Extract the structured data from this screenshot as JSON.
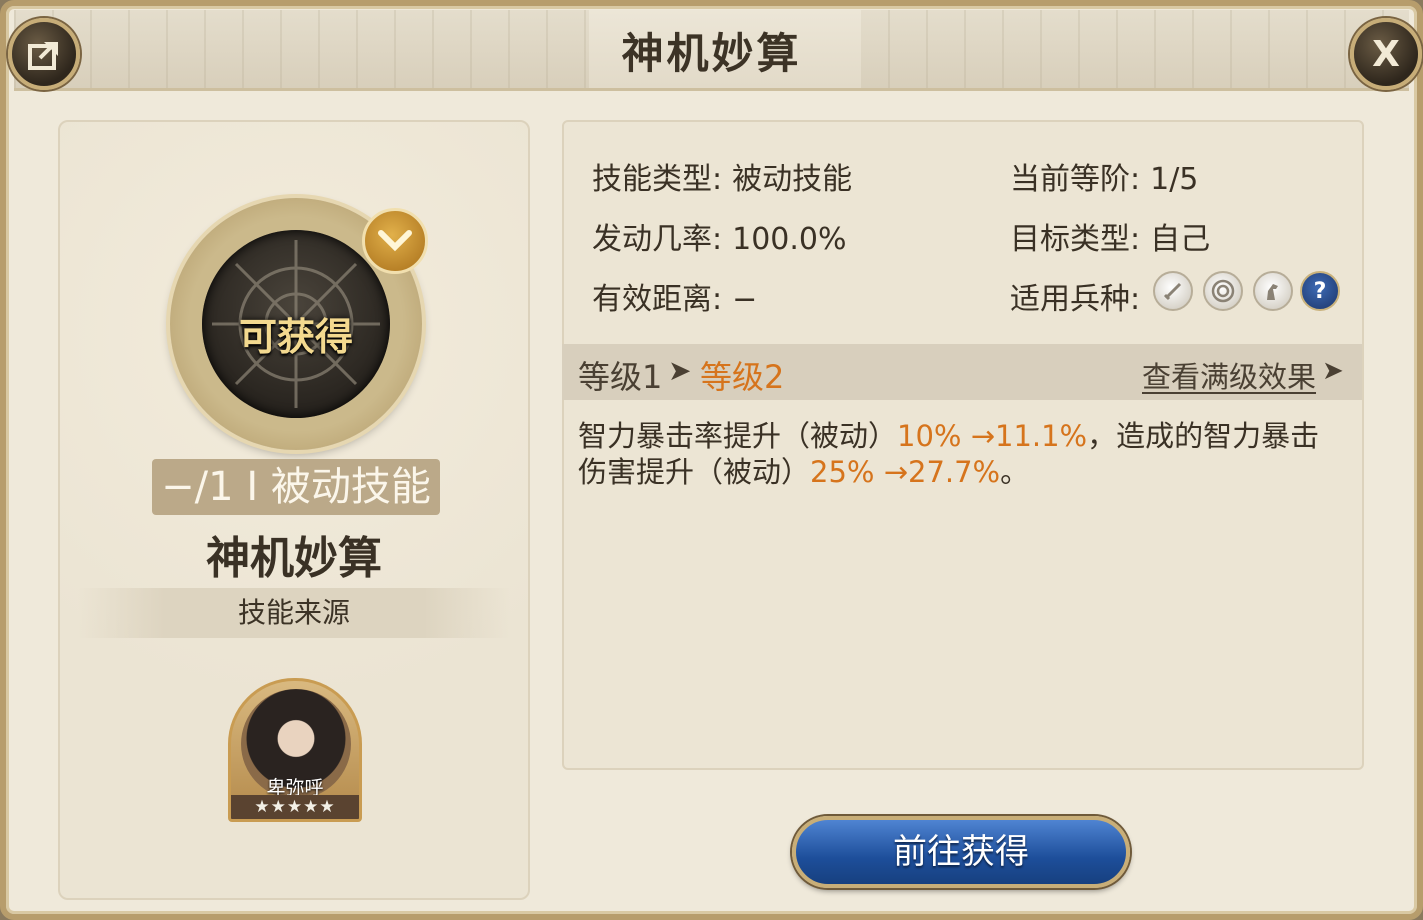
{
  "dialog": {
    "title": "神机妙算",
    "close_label": "X"
  },
  "skill": {
    "status": "可获得",
    "level_type": "−/1 I 被动技能",
    "name": "神机妙算",
    "source_label": "技能来源"
  },
  "hero": {
    "name": "卑弥呼",
    "stars": "★★★★★",
    "star_count": 5
  },
  "info": {
    "skill_type_label": "技能类型:",
    "skill_type_value": "被动技能",
    "current_rank_label": "当前等阶:",
    "current_rank_value": "1/5",
    "trigger_rate_label": "发动几率:",
    "trigger_rate_value": "100.0%",
    "target_type_label": "目标类型:",
    "target_type_value": "自己",
    "range_label": "有效距离:",
    "range_value": "−",
    "troops_label": "适用兵种:",
    "troop_icons": [
      "sword-icon",
      "target-icon",
      "horse-icon",
      "question-icon"
    ]
  },
  "levels": {
    "from": "等级1",
    "to": "等级2",
    "max_effect_link": "查看满级效果"
  },
  "description": {
    "part1": "智力暴击率提升（被动）",
    "val1": "10% →11.1%",
    "part2": "，造成的智力暴击伤害提升（被动）",
    "val2": "25% →27.7%",
    "part3": "。"
  },
  "actions": {
    "go_obtain": "前往获得"
  },
  "colors": {
    "highlight": "#d6741c",
    "button_blue": "#1d4e9a",
    "panel_bg": "#efe9da",
    "gold_border": "#b79d6c"
  }
}
